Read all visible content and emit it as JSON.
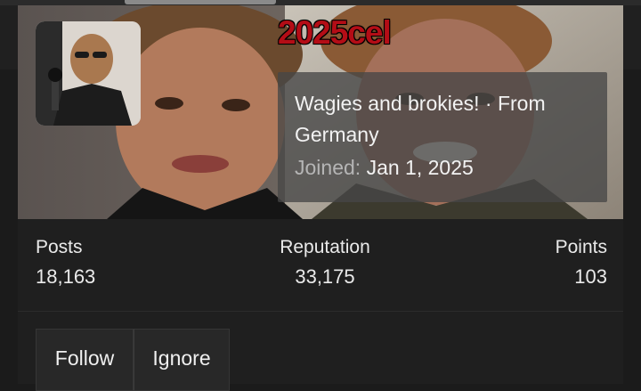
{
  "profile": {
    "username": "2025cel",
    "bio": "Wagies and brokies! · From Germany",
    "joined_label": "Joined:",
    "joined_date": "Jan 1, 2025",
    "username_color": "#b40d16"
  },
  "stats": [
    {
      "label": "Posts",
      "value": "18,163"
    },
    {
      "label": "Reputation",
      "value": "33,175"
    },
    {
      "label": "Points",
      "value": "103"
    }
  ],
  "actions": {
    "follow_label": "Follow",
    "ignore_label": "Ignore"
  },
  "icons": {
    "avatar": "avatar-photo",
    "banner": "banner-photo"
  }
}
